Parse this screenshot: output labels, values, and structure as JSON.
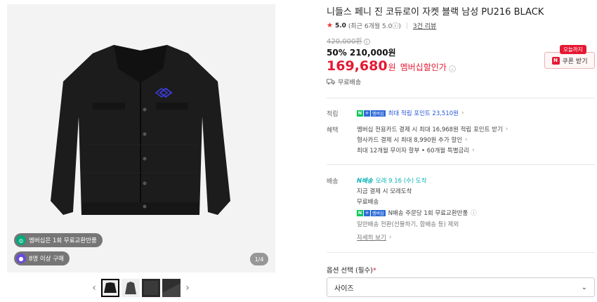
{
  "gallery": {
    "badges": [
      {
        "icon": "membership-icon",
        "text": "멤버십은 1회 무료교환반품",
        "color": "#03a87b"
      },
      {
        "icon": "people-icon",
        "text": "8명 이상 구매",
        "color": "#6b4bd8"
      }
    ],
    "counter": "1/4",
    "thumbs": [
      "thumb-1",
      "thumb-2",
      "thumb-3",
      "thumb-4"
    ]
  },
  "product": {
    "title": "니들스 페니 진 코듀로이 자켓 블랙 남성 PU216 BLACK",
    "rating": {
      "star": "★",
      "score": "5.0",
      "sub": "(최근 6개월 5.0",
      "sub_icon": "ⓘ",
      "sub_close": ")",
      "reviews": "3건 리뷰"
    },
    "original_price": "420,000원",
    "sale": "50% 210,000원",
    "member_price": {
      "number": "169,680",
      "won": "원",
      "label": "멤버십할인가"
    },
    "coupon": {
      "tag": "오늘까지",
      "label": "쿠폰 받기",
      "icon": "N"
    },
    "free_shipping": "무료배송"
  },
  "benefits": {
    "points_label": "적립",
    "points_text": "최대 적립 포인트 23,510원",
    "extra_label": "혜택",
    "lines": [
      "멤버십 전용카드 결제 시 최대 16,968원 적립 포인트 받기",
      "형사카드 결제 시 최대 8,990원 추가 할인",
      "최대 12개월 무이자 할부 • 60개월 특별금리"
    ]
  },
  "delivery": {
    "label": "배송",
    "badge": "N배송",
    "arrival": "모레 9.16 (수) 도착",
    "lines": [
      "지금 결제 시 모레도착",
      "무료배송"
    ],
    "exchange": "N배송 주문당 1회 무료교환반품",
    "note": "일반배송 전환(선물하기, 합배송 등) 제외",
    "more": "자세히 보기"
  },
  "option": {
    "label": "옵션 선택 (필수)",
    "required_mark": "*",
    "select_value": "사이즈"
  },
  "badges_npay": {
    "n": "N",
    "plus": "+",
    "membership": "멤버십"
  }
}
